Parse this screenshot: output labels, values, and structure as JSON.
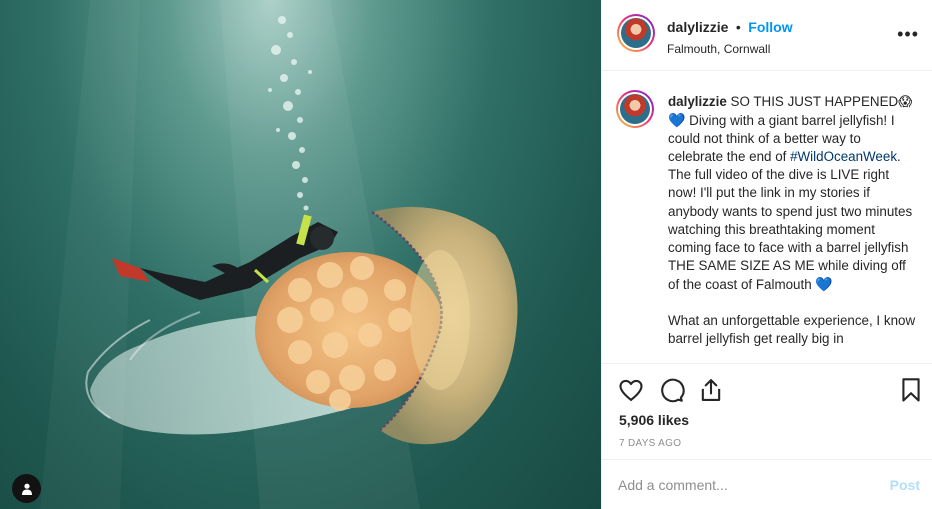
{
  "post": {
    "username": "dalylizzie",
    "separator": "•",
    "follow_label": "Follow",
    "location": "Falmouth, Cornwall",
    "more_label": "•••"
  },
  "caption": {
    "username": "dalylizzie",
    "text_1": " SO THIS JUST HAPPENED",
    "emoji_1": "😱",
    "emoji_2": "💙",
    "text_2": " Diving with a giant barrel jellyfish! I could not think of a better way to celebrate the end of ",
    "hashtag": "#WildOceanWeek",
    "text_3": ". The full video of the dive is LIVE right now! I'll put the link in my stories if anybody wants to spend just two minutes watching this breathtaking moment coming face to face with a barrel jellyfish THE SAME SIZE AS ME while diving off of the coast of Falmouth ",
    "emoji_3": "💙",
    "text_4": "\n\nWhat an unforgettable experience, I know barrel jellyfish get really big in"
  },
  "actions": {
    "likes": "5,906 likes",
    "timestamp": "7 DAYS AGO"
  },
  "comment": {
    "placeholder": "Add a comment...",
    "post_label": "Post"
  },
  "icons": {
    "like": "heart-icon",
    "comment": "comment-icon",
    "share": "share-icon",
    "save": "bookmark-icon",
    "tag": "user-tag-icon"
  },
  "colors": {
    "accent": "#0095f6",
    "post_disabled": "#b2dffc",
    "hashtag": "#00376b",
    "muted": "#8e8e8e"
  }
}
